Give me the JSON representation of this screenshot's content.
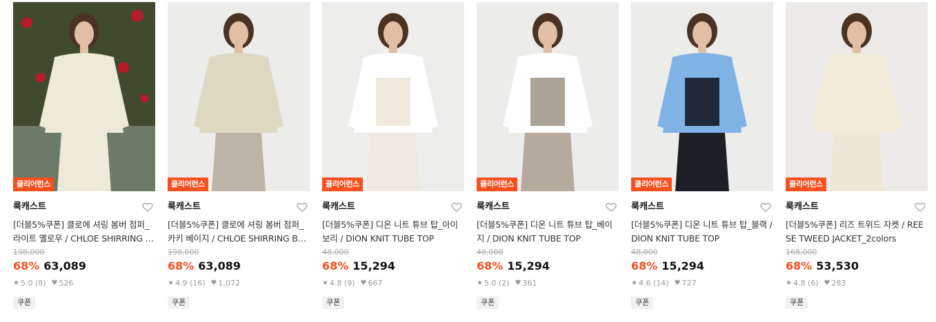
{
  "products": [
    {
      "badge": "클리어런스",
      "brand": "룩캐스트",
      "title": "[더블5%쿠폰] 클로에 셔링 봄버 점퍼_라이트 옐로우 / CHLOE SHIRRING BOMBER JUMPER",
      "original_price": "198,000",
      "discount": "68%",
      "price": "63,089",
      "rating": "5.0 (8)",
      "likes": "526",
      "coupon": "쿠폰",
      "colors": {
        "bg": "#3f4a2e",
        "garment": "#eeead8",
        "skirt": "#eeead8",
        "top": "#eeead8"
      }
    },
    {
      "badge": "클리어런스",
      "brand": "룩캐스트",
      "title": "[더블5%쿠폰] 클로에 셔링 봄버 점퍼_카키 베이지 / CHLOE SHIRRING BOMBER JUMPER",
      "original_price": "198,000",
      "discount": "68%",
      "price": "63,089",
      "rating": "4.9 (16)",
      "likes": "1,072",
      "coupon": "쿠폰",
      "colors": {
        "bg": "#ececea",
        "garment": "#dcd8c2",
        "skirt": "#bdb3a6",
        "top": "#dcd8c2"
      }
    },
    {
      "badge": "클리어런스",
      "brand": "룩캐스트",
      "title": "[더블5%쿠폰] 디온 니트 튜브 탑_아이보리 / DION KNIT TUBE TOP",
      "original_price": "48,000",
      "discount": "68%",
      "price": "15,294",
      "rating": "4.8 (9)",
      "likes": "667",
      "coupon": "쿠폰",
      "colors": {
        "bg": "#ededeb",
        "garment": "#ffffff",
        "skirt": "#eeeae0",
        "top": "#efe8dc"
      }
    },
    {
      "badge": "클리어런스",
      "brand": "룩캐스트",
      "title": "[더블5%쿠폰] 디온 니트 튜브 탑_베이지 / DION KNIT TUBE TOP",
      "original_price": "48,000",
      "discount": "68%",
      "price": "15,294",
      "rating": "5.0 (2)",
      "likes": "361",
      "coupon": "쿠폰",
      "colors": {
        "bg": "#ececea",
        "garment": "#ffffff",
        "skirt": "#b5aa9c",
        "top": "#a89d90"
      }
    },
    {
      "badge": "클리어런스",
      "brand": "룩캐스트",
      "title": "[더블5%쿠폰] 디온 니트 튜브 탑_블랙 / DION KNIT TUBE TOP",
      "original_price": "48,000",
      "discount": "68%",
      "price": "15,294",
      "rating": "4.6 (14)",
      "likes": "727",
      "coupon": "쿠폰",
      "colors": {
        "bg": "#ececea",
        "garment": "#7fb3e6",
        "skirt": "#1c1f26",
        "top": "#1c2130"
      }
    },
    {
      "badge": "클리어런스",
      "brand": "룩캐스트",
      "title": "[더블5%쿠폰] 리즈 트위드 자켓 / REESE TWEED JACKET_2colors",
      "original_price": "168,000",
      "discount": "68%",
      "price": "53,530",
      "rating": "4.8 (6)",
      "likes": "283",
      "coupon": "쿠폰",
      "colors": {
        "bg": "#ebeae8",
        "garment": "#f1ebda",
        "skirt": "#efe7d5",
        "top": "#f1ebda"
      }
    }
  ],
  "icons": {
    "heart": "heart-outline-icon",
    "star": "star-icon",
    "like": "heart-filled-icon"
  },
  "accent_color": "#f5501e"
}
